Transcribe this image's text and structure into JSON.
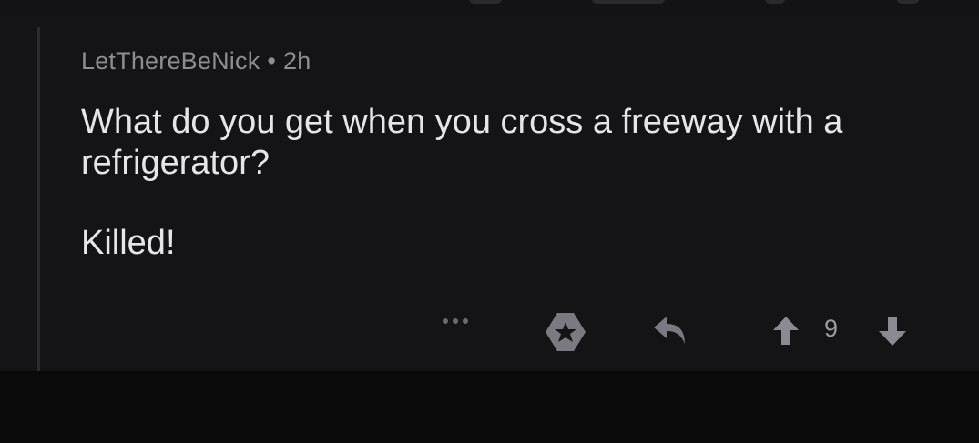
{
  "comment": {
    "author": "LetThereBeNick",
    "separator": "•",
    "age": "2h",
    "paragraphs": [
      "What do you get when you cross a freeway with a refrigerator?",
      "Killed!"
    ],
    "vote_count": "9"
  },
  "actions": {
    "more_icon": "more-dots-icon",
    "award_icon": "award-badge-icon",
    "reply_icon": "reply-arrow-icon",
    "upvote_icon": "arrow-up-icon",
    "downvote_icon": "arrow-down-icon"
  },
  "colors": {
    "background": "#141416",
    "text_primary": "#e6e6e8",
    "text_secondary": "#8d8d92",
    "icon": "#7a7a80"
  }
}
